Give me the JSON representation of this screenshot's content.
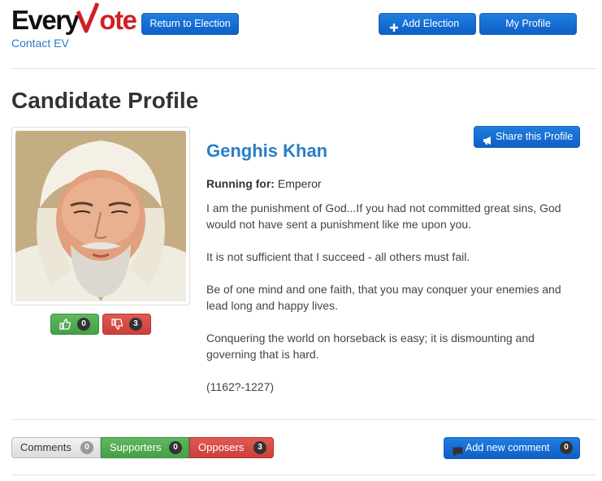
{
  "header": {
    "logo_prefix": "Every",
    "logo_suffix": "ote",
    "contact_link": "Contact EV",
    "return_button": "Return to Election",
    "add_election_button": "Add Election",
    "my_profile_button": "My Profile"
  },
  "page_title": "Candidate Profile",
  "candidate": {
    "name": "Genghis Khan",
    "running_label": "Running for:",
    "running_value": "Emperor",
    "share_button": "Share this Profile",
    "bio": [
      "I am the punishment of God...If you had not committed great sins, God would not have sent a punishment like me upon you.",
      "It is not sufficient that I succeed - all others must fail.",
      "Be of one mind and one faith, that you may conquer your enemies and lead long and happy lives.",
      "Conquering the world on horseback is easy; it is dismounting and governing that is hard.",
      "(1162?-1227)"
    ],
    "votes_up": "0",
    "votes_down": "3"
  },
  "tabs": {
    "comments_label": "Comments",
    "comments_count": "0",
    "supporters_label": "Supporters",
    "supporters_count": "0",
    "opposers_label": "Opposers",
    "opposers_count": "3"
  },
  "add_comment": {
    "label": "Add new comment",
    "count": "0"
  },
  "colors": {
    "brand_red": "#d01f26",
    "link_blue": "#2a78c8",
    "button_blue": "#1f7ee0",
    "success_green": "#46a046",
    "danger_red": "#cc3f3a"
  }
}
